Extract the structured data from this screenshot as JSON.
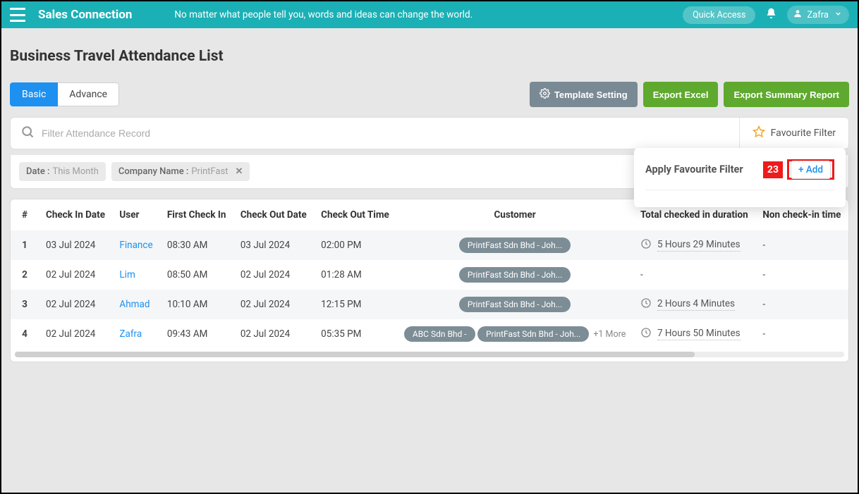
{
  "header": {
    "brand": "Sales Connection",
    "tagline": "No matter what people tell you, words and ideas can change the world.",
    "quick_access": "Quick Access",
    "user_name": "Zafra"
  },
  "page": {
    "title": "Business Travel Attendance List"
  },
  "tabs": {
    "basic": "Basic",
    "advance": "Advance"
  },
  "buttons": {
    "template_setting": "Template Setting",
    "export_excel": "Export Excel",
    "export_summary": "Export Summary Report"
  },
  "filter": {
    "search_placeholder": "Filter Attendance Record",
    "favourite_label": "Favourite Filter",
    "chips": {
      "date_label": "Date :",
      "date_value": "This Month",
      "company_label": "Company Name :",
      "company_value": "PrintFast"
    }
  },
  "popup": {
    "title": "Apply Favourite Filter",
    "badge": "23",
    "add_label": "+ Add"
  },
  "table": {
    "headers": {
      "idx": "#",
      "checkin_date": "Check In Date",
      "user": "User",
      "first_checkin": "First Check In",
      "checkout_date": "Check Out Date",
      "checkout_time": "Check Out Time",
      "customer": "Customer",
      "total_duration": "Total checked in duration",
      "non_checkin": "Non check-in time"
    },
    "rows": [
      {
        "idx": "1",
        "checkin_date": "03 Jul 2024",
        "user": "Finance",
        "first_checkin": "08:30 AM",
        "checkout_date": "03 Jul 2024",
        "checkout_time": "02:00 PM",
        "customers": [
          "PrintFast Sdn Bhd - Joh..."
        ],
        "more": "",
        "duration": "5 Hours 29 Minutes",
        "non_checkin": "-"
      },
      {
        "idx": "2",
        "checkin_date": "02 Jul 2024",
        "user": "Lim",
        "first_checkin": "08:50 AM",
        "checkout_date": "02 Jul 2024",
        "checkout_time": "01:28 AM",
        "customers": [
          "PrintFast Sdn Bhd - Joh..."
        ],
        "more": "",
        "duration": "-",
        "non_checkin": "-"
      },
      {
        "idx": "3",
        "checkin_date": "02 Jul 2024",
        "user": "Ahmad",
        "first_checkin": "10:10 AM",
        "checkout_date": "02 Jul 2024",
        "checkout_time": "12:15 PM",
        "customers": [
          "PrintFast Sdn Bhd - Joh..."
        ],
        "more": "",
        "duration": "2 Hours 4 Minutes",
        "non_checkin": "-"
      },
      {
        "idx": "4",
        "checkin_date": "02 Jul 2024",
        "user": "Zafra",
        "first_checkin": "09:43 AM",
        "checkout_date": "02 Jul 2024",
        "checkout_time": "05:35 PM",
        "customers": [
          "ABC Sdn Bhd -",
          "PrintFast Sdn Bhd - Joh..."
        ],
        "more": "+1 More",
        "duration": "7 Hours 50 Minutes",
        "non_checkin": "-"
      }
    ]
  }
}
